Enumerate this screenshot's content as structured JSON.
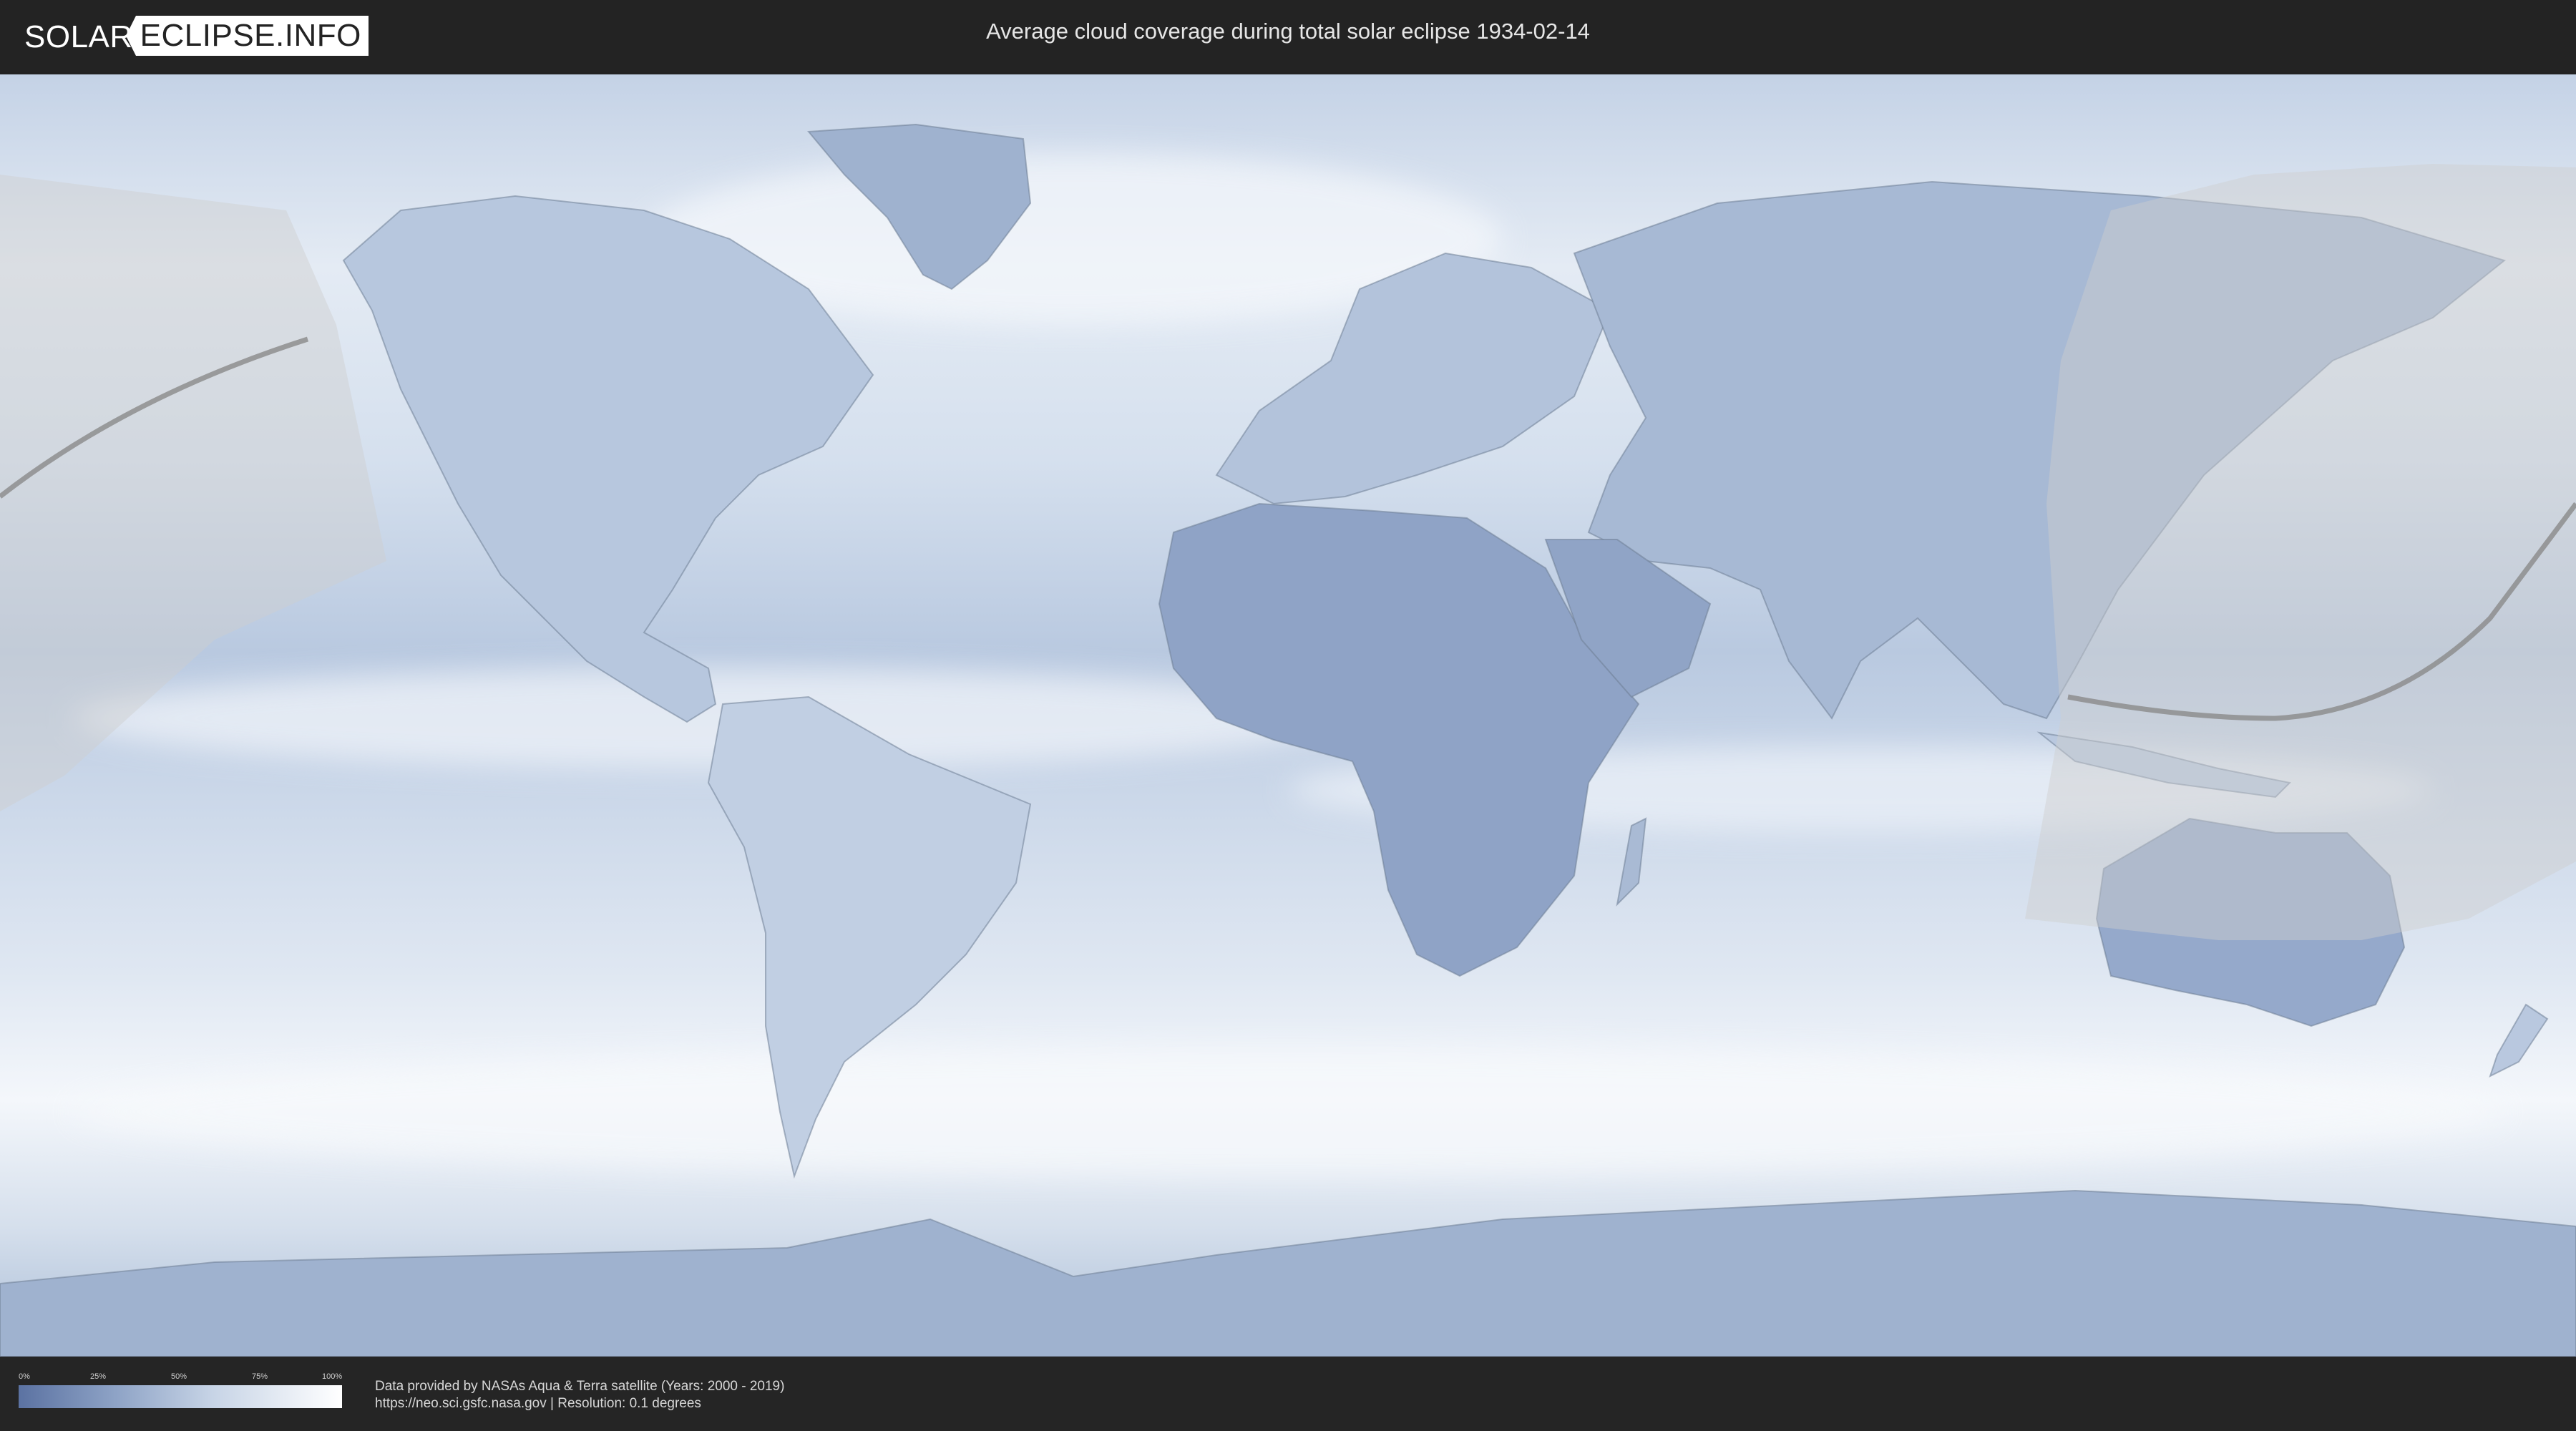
{
  "header": {
    "logo_left": "SOLAR",
    "logo_right": "ECLIPSE.INFO",
    "title": "Average cloud coverage during total solar eclipse 1934-02-14"
  },
  "map": {
    "colors": {
      "clear_sky": "#5b72a2",
      "full_cloud": "#ffffff",
      "eclipse_overlay": "#cfcfcf",
      "central_line": "#8a8a8a",
      "border": "#6f7f95"
    }
  },
  "legend": {
    "ticks": [
      "0%",
      "25%",
      "50%",
      "75%",
      "100%"
    ]
  },
  "credits": {
    "line1": "Data provided by NASAs Aqua & Terra satellite (Years: 2000 - 2019)",
    "line2": "https://neo.sci.gsfc.nasa.gov | Resolution: 0.1 degrees"
  }
}
